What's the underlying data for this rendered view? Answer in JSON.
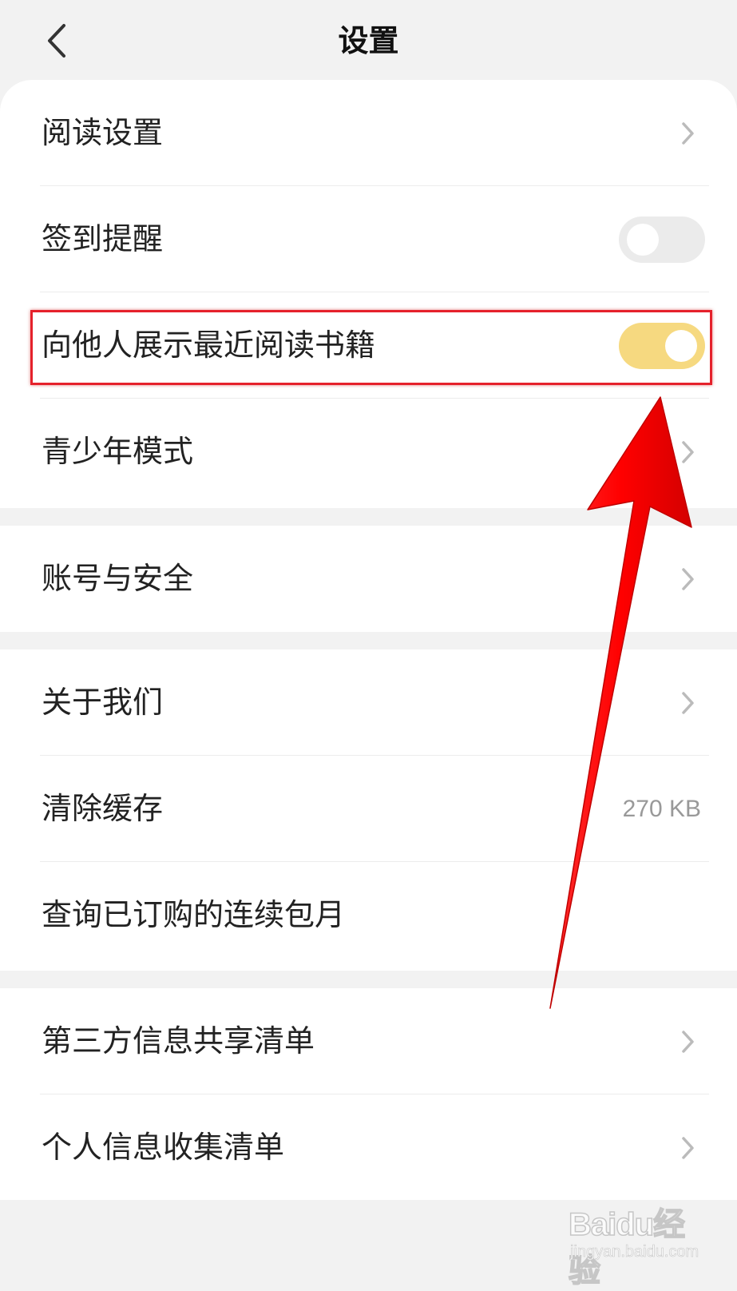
{
  "header": {
    "title": "设置"
  },
  "sections": [
    {
      "items": [
        {
          "label": "阅读设置",
          "control": "chevron"
        },
        {
          "label": "签到提醒",
          "control": "toggle",
          "state": "off"
        },
        {
          "label": "向他人展示最近阅读书籍",
          "control": "toggle",
          "state": "on"
        },
        {
          "label": "青少年模式",
          "control": "chevron"
        }
      ]
    },
    {
      "items": [
        {
          "label": "账号与安全",
          "control": "chevron"
        }
      ]
    },
    {
      "items": [
        {
          "label": "关于我们",
          "control": "chevron"
        },
        {
          "label": "清除缓存",
          "control": "value",
          "value": "270 KB"
        },
        {
          "label": "查询已订购的连续包月",
          "control": "none"
        }
      ]
    },
    {
      "items": [
        {
          "label": "第三方信息共享清单",
          "control": "chevron"
        },
        {
          "label": "个人信息收集清单",
          "control": "chevron"
        }
      ]
    }
  ],
  "watermark": {
    "logo": "Baidu经验",
    "url": "jingyan.baidu.com"
  },
  "colors": {
    "page_background": "#f2f2f2",
    "card_background": "#ffffff",
    "toggle_on": "#f6d980",
    "toggle_off": "#ebebeb",
    "annotation_red": "#e5212b",
    "chevron": "#bbbbbb"
  },
  "icons": {
    "back": "chevron-left-icon",
    "row_arrow": "chevron-right-icon"
  }
}
